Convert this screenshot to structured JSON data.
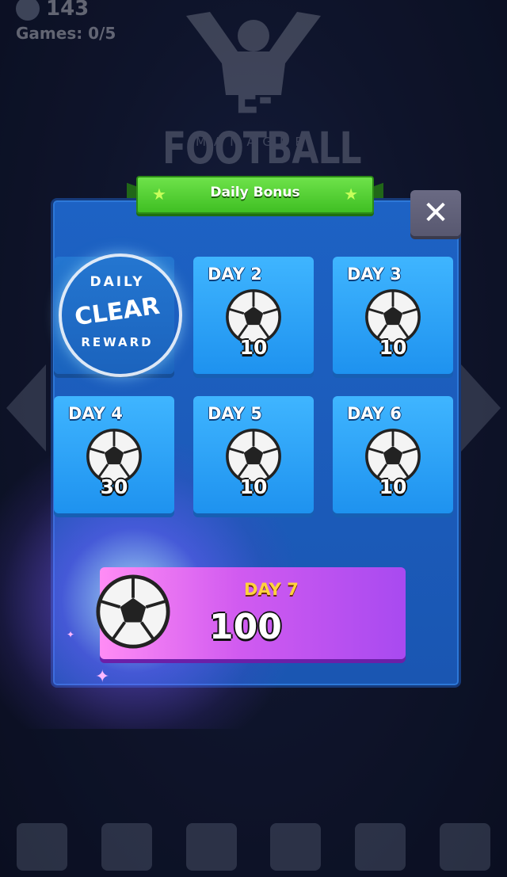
{
  "hud": {
    "coins": "143",
    "games": "Games: 0/5"
  },
  "logo": {
    "title": "E-FOOTBALL",
    "subtitle": "MANAGER"
  },
  "dialog": {
    "title": "Daily Bonus",
    "close_icon": "close-icon",
    "claimed_stamp": {
      "top": "DAILY",
      "main": "CLEAR",
      "bottom": "REWARD"
    },
    "days": [
      {
        "label": "DAY 2",
        "amount": "10"
      },
      {
        "label": "DAY 3",
        "amount": "10"
      },
      {
        "label": "DAY 4",
        "amount": "30"
      },
      {
        "label": "DAY 5",
        "amount": "10"
      },
      {
        "label": "DAY 6",
        "amount": "10"
      }
    ],
    "final_day": {
      "label": "DAY 7",
      "amount": "100"
    }
  },
  "bottom_nav": [
    "podium-icon",
    "checklist-icon",
    "shop-icon",
    "pickaxe-icon",
    "rocket-icon",
    "calendar-icon"
  ],
  "colors": {
    "panel": "#1a56b2",
    "tile": "#2ea3fa",
    "banner": "#4fcf2e",
    "final_tile": "#d15bf0",
    "gold": "#ffd23d"
  }
}
